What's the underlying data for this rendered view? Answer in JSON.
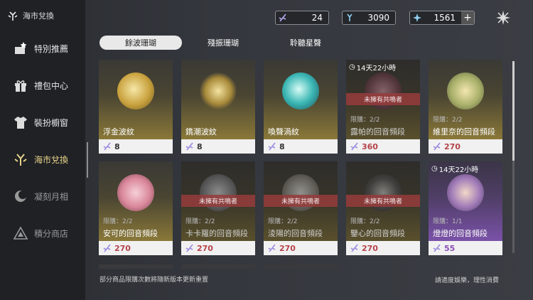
{
  "window": {
    "title": "海市兌換"
  },
  "sidebar": {
    "items": [
      {
        "label": "特別推薦",
        "icon": "gift-star-icon"
      },
      {
        "label": "禮包中心",
        "icon": "gift-box-icon"
      },
      {
        "label": "裝扮櫥窗",
        "icon": "shirt-icon"
      },
      {
        "label": "海市兌換",
        "icon": "coral-icon",
        "active": true
      },
      {
        "label": "凝刻月相",
        "icon": "moon-icon"
      },
      {
        "label": "積分商店",
        "icon": "triangle-icon"
      }
    ]
  },
  "currency": [
    {
      "icon": "coral-shard-icon",
      "value": "24"
    },
    {
      "icon": "coral-blue-icon",
      "value": "3090"
    },
    {
      "icon": "star-icon",
      "value": "1561",
      "has_plus": true,
      "plus_label": "+"
    }
  ],
  "tabs": [
    {
      "label": "餘波珊瑚",
      "active": true
    },
    {
      "label": "殘振珊瑚"
    },
    {
      "label": "聆聽星聲"
    }
  ],
  "items": [
    {
      "name": "浮金波紋",
      "price": "8",
      "orb": "gold"
    },
    {
      "name": "鐫潮波紋",
      "price": "8",
      "orb": "gold"
    },
    {
      "name": "喚聲渦紋",
      "price": "8",
      "orb": "teal"
    },
    {
      "name": "露帕的回音頻段",
      "price": "360",
      "limit": "限購：2/2",
      "timer": "14天22小時",
      "locked": "未擁有共鳴者"
    },
    {
      "name": "維里奈的回音頻段",
      "price": "270",
      "limit": "限購：2/2"
    },
    {
      "name": "安可的回音頻段",
      "price": "270",
      "limit": "限購：2/2"
    },
    {
      "name": "卡卡羅的回音頻段",
      "price": "270",
      "limit": "限購：2/2",
      "locked": "未擁有共鳴者"
    },
    {
      "name": "淩陽的回音頻段",
      "price": "270",
      "limit": "限購：2/2",
      "locked": "未擁有共鳴者"
    },
    {
      "name": "鑒心的回音頻段",
      "price": "270",
      "limit": "限購：2/2",
      "locked": "未擁有共鳴者"
    },
    {
      "name": "燈燈的回音頻段",
      "price": "55",
      "limit": "限購：1/1",
      "timer": "14天22小時",
      "purple": true
    }
  ],
  "footer": {
    "note": "部分商品限購次數將隨新版本更新重置",
    "health": "請適度娛樂，理性消費"
  }
}
